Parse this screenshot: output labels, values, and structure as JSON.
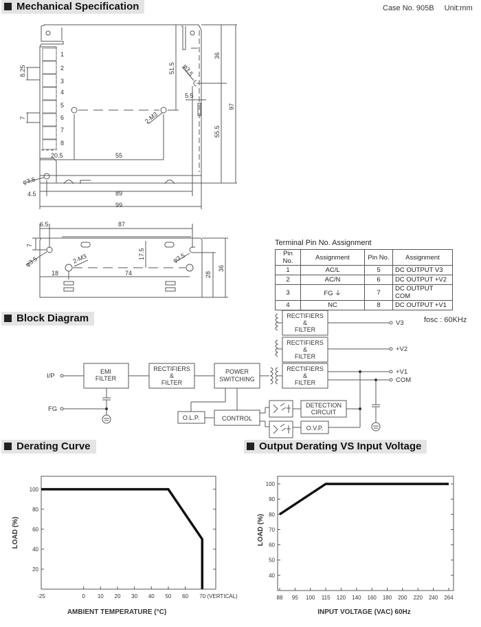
{
  "sections": {
    "mechanical": "Mechanical Specification",
    "block": "Block Diagram",
    "derating": "Derating Curve",
    "input_derating": "Output Derating VS Input Voltage"
  },
  "case_info": {
    "case_no": "Case No. 905B",
    "unit": "Unit:mm"
  },
  "mechanical_top": {
    "terminal_numbers": [
      "1",
      "2",
      "3",
      "4",
      "5",
      "6",
      "7",
      "8"
    ],
    "dims": {
      "pitch": "8.25",
      "seven": "7",
      "left": "20.5",
      "mid": "55",
      "offset": "4.5",
      "inner_width": "89",
      "width": "99",
      "hole_v": "51.5",
      "hole_d": "φ3.5",
      "slot": "5.5",
      "top36": "36",
      "bot": "55.5",
      "height": "97",
      "screw": "2-M3",
      "hole_d2": "φ3.5"
    }
  },
  "mechanical_side": {
    "dims": {
      "a": "6.5",
      "b": "87",
      "c": "7",
      "d": "17.5",
      "e": "18",
      "f": "74",
      "g": "28",
      "h": "36",
      "hole_l": "φ3.5",
      "hole_r": "φ3.5",
      "screw": "2-M3"
    }
  },
  "pin_table": {
    "title": "Terminal Pin No.  Assignment",
    "headers": [
      "Pin No.",
      "Assignment",
      "Pin No.",
      "Assignment"
    ],
    "rows": [
      [
        "1",
        "AC/L",
        "5",
        "DC OUTPUT V3"
      ],
      [
        "2",
        "AC/N",
        "6",
        "DC OUTPUT +V2"
      ],
      [
        "3",
        "FG ⏚",
        "7",
        "DC OUTPUT COM"
      ],
      [
        "4",
        "NC",
        "8",
        "DC OUTPUT +V1"
      ]
    ]
  },
  "block_diagram": {
    "fosc": "fosc : 60KHz",
    "inputs": {
      "ip": "I/P",
      "fg": "FG"
    },
    "blocks": {
      "emi": [
        "EMI",
        "FILTER"
      ],
      "rect_in": [
        "RECTIFIERS",
        "&",
        "FILTER"
      ],
      "power": [
        "POWER",
        "SWITCHING"
      ],
      "olp": "O.L.P.",
      "control": "CONTROL",
      "rect1": [
        "RECTIFIERS",
        "&",
        "FILTER"
      ],
      "rect2": [
        "RECTIFIERS",
        "&",
        "FILTER"
      ],
      "rect3": [
        "RECTIFIERS",
        "&",
        "FILTER"
      ],
      "detection": [
        "DETECTION",
        "CIRCUIT"
      ],
      "ovp": "O.V.P."
    },
    "outputs": [
      "V3",
      "+V2",
      "+V1",
      "COM"
    ]
  },
  "chart_data": [
    {
      "type": "line",
      "title": "Derating Curve",
      "xlabel": "AMBIENT TEMPERATURE (°C)",
      "ylabel": "LOAD (%)",
      "x_ticks": [
        "-25",
        "0",
        "10",
        "20",
        "30",
        "40",
        "50",
        "60",
        "70 (VERTICAL)"
      ],
      "x_tick_values": [
        -25,
        0,
        10,
        20,
        30,
        40,
        50,
        60,
        70
      ],
      "y_ticks": [
        20,
        40,
        60,
        80,
        100
      ],
      "xlim": [
        -25,
        78
      ],
      "ylim": [
        0,
        113
      ],
      "series": [
        {
          "name": "Load",
          "x": [
            -25,
            50,
            70,
            70
          ],
          "y": [
            100,
            100,
            50,
            0
          ]
        }
      ],
      "grid": false
    },
    {
      "type": "line",
      "title": "Output Derating VS Input Voltage",
      "xlabel": "INPUT VOLTAGE (VAC) 60Hz",
      "ylabel": "LOAD (%)",
      "x_ticks": [
        "88",
        "95",
        "100",
        "115",
        "120",
        "140",
        "160",
        "180",
        "200",
        "220",
        "240",
        "264"
      ],
      "y_ticks": [
        40,
        50,
        60,
        70,
        80,
        90,
        100
      ],
      "ylim": [
        30,
        105
      ],
      "series": [
        {
          "name": "Load",
          "x": [
            "88",
            "115",
            "264"
          ],
          "y": [
            80,
            100,
            100
          ]
        }
      ],
      "grid": false
    }
  ]
}
